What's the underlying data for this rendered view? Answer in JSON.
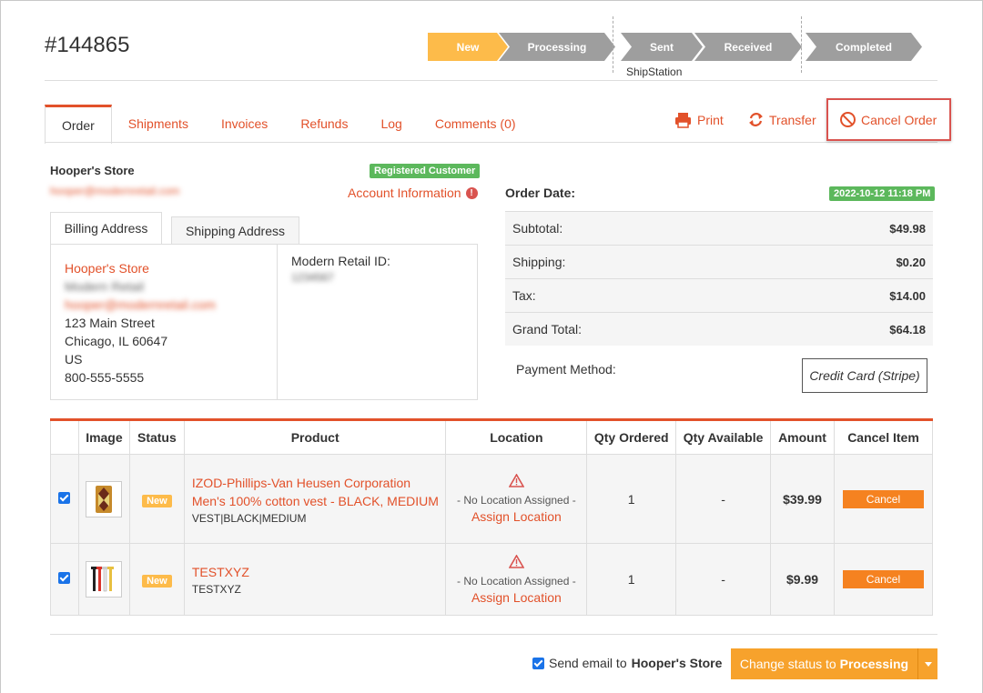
{
  "order": {
    "number": "#144865"
  },
  "progress": {
    "steps": [
      {
        "label": "New",
        "state": "active"
      },
      {
        "label": "Processing",
        "state": "inactive"
      },
      {
        "label": "Sent",
        "state": "inactive"
      },
      {
        "label": "Received",
        "state": "inactive"
      },
      {
        "label": "Completed",
        "state": "inactive"
      }
    ],
    "integration": "ShipStation"
  },
  "tabs": [
    {
      "label": "Order",
      "active": true
    },
    {
      "label": "Shipments"
    },
    {
      "label": "Invoices"
    },
    {
      "label": "Refunds"
    },
    {
      "label": "Log"
    },
    {
      "label": "Comments (0)"
    }
  ],
  "actions": {
    "print": "Print",
    "transfer": "Transfer",
    "cancel_order": "Cancel Order"
  },
  "customer": {
    "store": "Hooper's Store",
    "email_blurred": "hooper@modernretail.com",
    "badge": "Registered Customer",
    "account_info": "Account Information"
  },
  "address": {
    "tabs": [
      "Billing Address",
      "Shipping Address"
    ],
    "lines": {
      "name": "Hooper's Store",
      "contact_blurred": "Modern Retail",
      "email_blurred": "hooper@modernretail.com",
      "street": "123 Main Street",
      "city": "Chicago, IL 60647",
      "country": "US",
      "phone": "800-555-5555"
    },
    "modern_retail_id_label": "Modern Retail ID:",
    "modern_retail_id_blurred": "1234567"
  },
  "totals": {
    "order_date_label": "Order Date:",
    "order_date": "2022-10-12 11:18 PM",
    "rows": [
      {
        "label": "Subtotal:",
        "value": "$49.98"
      },
      {
        "label": "Shipping:",
        "value": "$0.20"
      },
      {
        "label": "Tax:",
        "value": "$14.00"
      },
      {
        "label": "Grand Total:",
        "value": "$64.18"
      }
    ],
    "payment_method_label": "Payment Method:",
    "payment_method": "Credit Card (Stripe)"
  },
  "items": {
    "headers": [
      "",
      "Image",
      "Status",
      "Product",
      "Location",
      "Qty Ordered",
      "Qty Available",
      "Amount",
      "Cancel Item"
    ],
    "rows": [
      {
        "status": "New",
        "product": "IZOD-Phillips-Van Heusen Corporation Men's 100% cotton vest - BLACK, MEDIUM",
        "sku": "VEST|BLACK|MEDIUM",
        "no_location": "- No Location Assigned -",
        "assign": "Assign Location",
        "qty_ordered": "1",
        "qty_available": "-",
        "amount": "$39.99",
        "cancel": "Cancel"
      },
      {
        "status": "New",
        "product": "TESTXYZ",
        "sku": "TESTXYZ",
        "no_location": "- No Location Assigned -",
        "assign": "Assign Location",
        "qty_ordered": "1",
        "qty_available": "-",
        "amount": "$9.99",
        "cancel": "Cancel"
      }
    ]
  },
  "footer": {
    "send_email_prefix": "Send email to",
    "send_email_store": "Hooper's Store",
    "change_status_prefix": "Change status to",
    "change_status_target": "Processing"
  },
  "colors": {
    "accent": "#e2512a",
    "step_active": "#fdbb4a",
    "step_inactive": "#9e9e9e",
    "button": "#f7a22c",
    "success": "#5cb85c"
  }
}
